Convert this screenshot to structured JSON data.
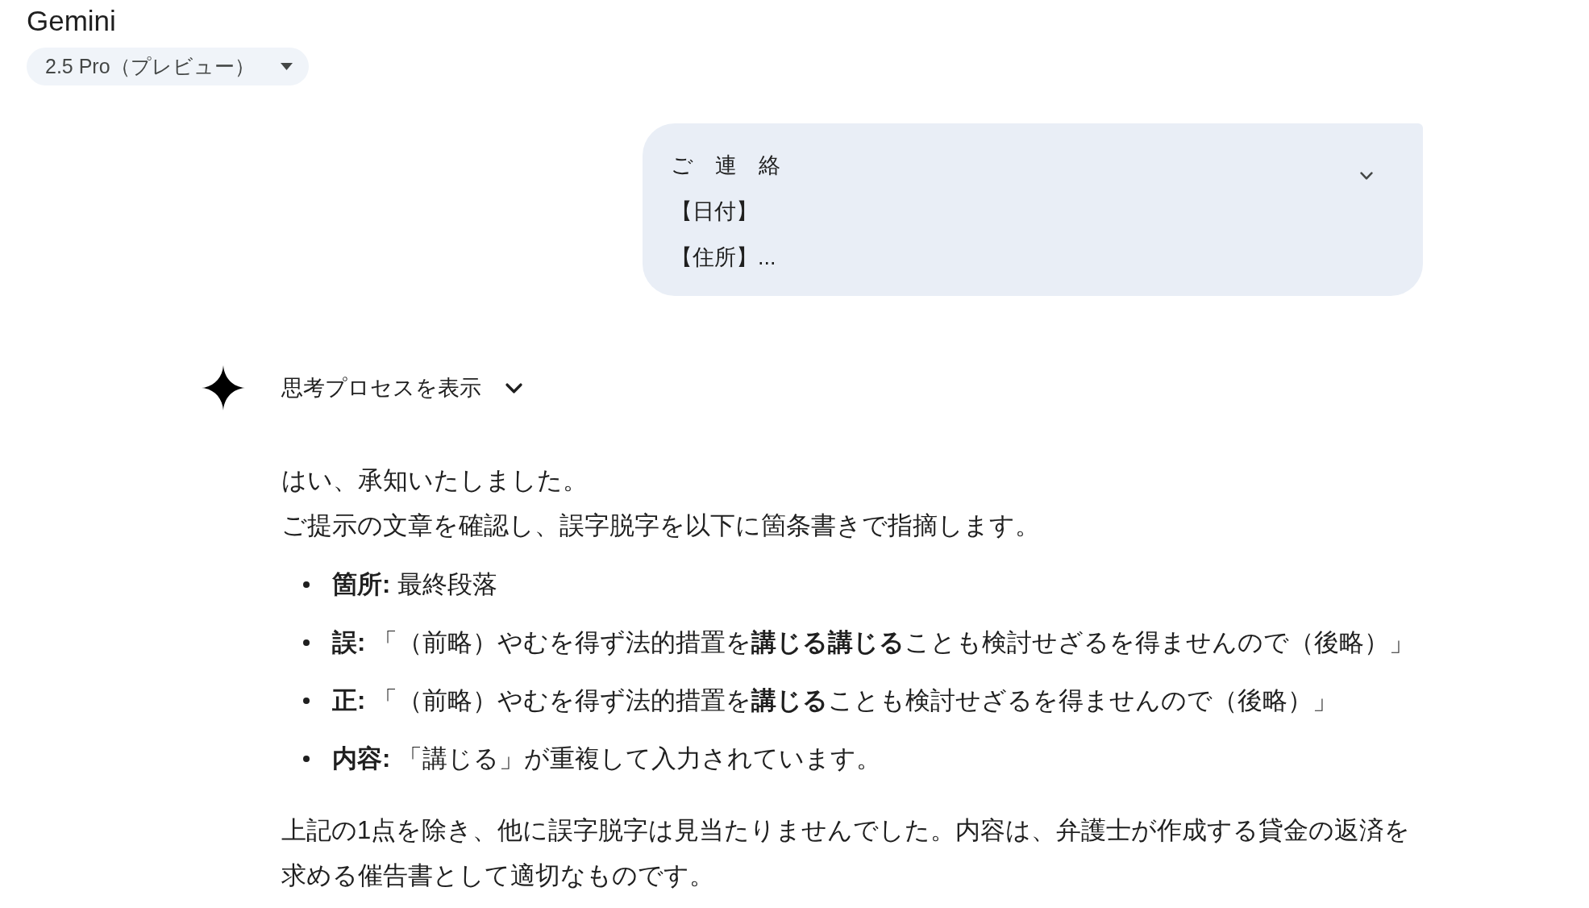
{
  "header": {
    "title": "Gemini",
    "model_selector": {
      "label": "2.5 Pro（プレビュー）"
    }
  },
  "user_message": {
    "lines": [
      "ご　連　絡",
      "【日付】",
      "【住所】..."
    ],
    "expanded": false
  },
  "response": {
    "thoughts_toggle": {
      "label": "思考プロセスを表示",
      "expanded": false
    },
    "intro": [
      "はい、承知いたしました。",
      "ご提示の文章を確認し、誤字脱字を以下に箇条書きで指摘します。"
    ],
    "bullets": [
      "**箇所:** 最終段落",
      "**誤:** 「（前略）やむを得ず法的措置を**講じる講じる**ことも検討せざるを得ませんので（後略）」",
      "**正:** 「（前略）やむを得ず法的措置を**講じる**ことも検討せざるを得ませんので（後略）」",
      "**内容:** 「講じる」が重複して入力されています。"
    ],
    "closing": "上記の1点を除き、他に誤字脱字は見当たりませんでした。内容は、弁護士が作成する貸金の返済を求める催告書として適切なものです。"
  }
}
